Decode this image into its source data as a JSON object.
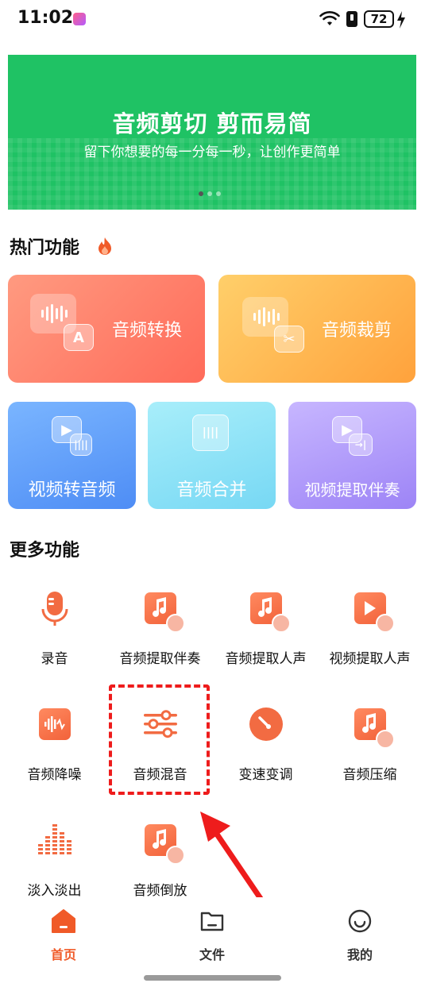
{
  "status_bar": {
    "time": "11:02",
    "battery": "72"
  },
  "banner": {
    "title": "音频剪切 剪而易简",
    "subtitle": "留下你想要的每一分每一秒，让创作更简单",
    "colors": {
      "background": "#1fc264"
    }
  },
  "hot_section": {
    "title": "热门功能",
    "icon": "fire-icon",
    "cards": [
      {
        "label": "音频转换",
        "icon": "audio-convert-icon"
      },
      {
        "label": "音频裁剪",
        "icon": "audio-crop-icon"
      },
      {
        "label": "视频转音频",
        "icon": "video-to-audio-icon"
      },
      {
        "label": "音频合并",
        "icon": "audio-merge-icon"
      },
      {
        "label": "视频提取伴奏",
        "icon": "video-accompaniment-icon"
      }
    ]
  },
  "more_section": {
    "title": "更多功能",
    "items": [
      {
        "label": "录音",
        "icon": "microphone-icon"
      },
      {
        "label": "音频提取伴奏",
        "icon": "audio-extract-accompaniment-icon"
      },
      {
        "label": "音频提取人声",
        "icon": "audio-extract-vocal-icon"
      },
      {
        "label": "视频提取人声",
        "icon": "video-extract-vocal-icon"
      },
      {
        "label": "音频降噪",
        "icon": "noise-reduction-icon"
      },
      {
        "label": "音频混音",
        "icon": "mixer-sliders-icon"
      },
      {
        "label": "变速变调",
        "icon": "speed-pitch-icon"
      },
      {
        "label": "音频压缩",
        "icon": "audio-compress-icon"
      },
      {
        "label": "淡入淡出",
        "icon": "fade-bars-icon"
      },
      {
        "label": "音频倒放",
        "icon": "audio-reverse-icon"
      }
    ]
  },
  "bottom_nav": {
    "items": [
      {
        "label": "首页",
        "icon": "home-icon",
        "active": true
      },
      {
        "label": "文件",
        "icon": "folder-icon",
        "active": false
      },
      {
        "label": "我的",
        "icon": "profile-smile-icon",
        "active": false
      }
    ]
  },
  "colors": {
    "accent": "#f05a28",
    "annotation": "#ee1c1c"
  }
}
